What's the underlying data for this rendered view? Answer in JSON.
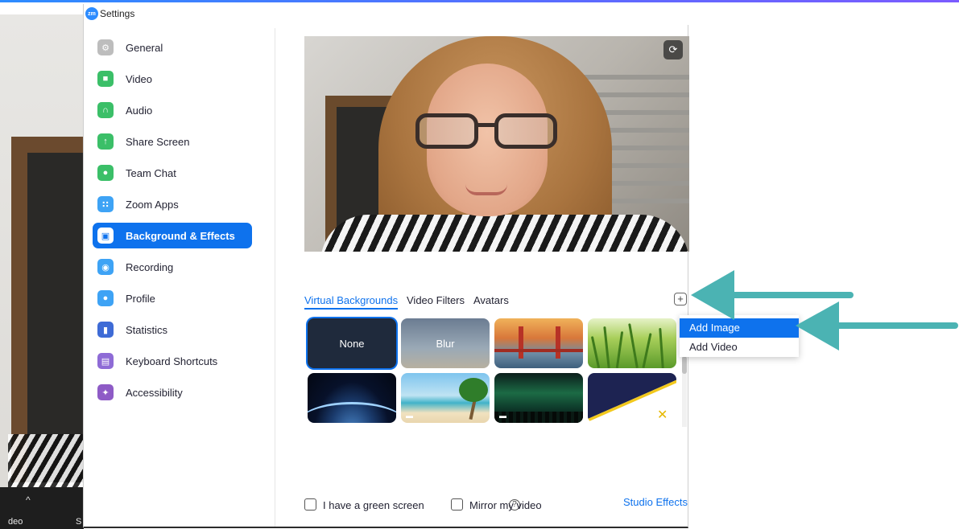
{
  "window": {
    "title": "Settings",
    "app_icon_text": "zm"
  },
  "sidebar": {
    "items": [
      {
        "label": "General",
        "icon": "gear-icon",
        "color": "#b6b6b6",
        "glyph": "⚙"
      },
      {
        "label": "Video",
        "icon": "video-camera-icon",
        "color": "#3bbf68",
        "glyph": "■"
      },
      {
        "label": "Audio",
        "icon": "headphones-icon",
        "color": "#3bbf68",
        "glyph": "∩"
      },
      {
        "label": "Share Screen",
        "icon": "share-screen-icon",
        "color": "#3bbf68",
        "glyph": "↑"
      },
      {
        "label": "Team Chat",
        "icon": "chat-bubble-icon",
        "color": "#3bbf68",
        "glyph": "●"
      },
      {
        "label": "Zoom Apps",
        "icon": "apps-icon",
        "color": "#3ea3f5",
        "glyph": "∷"
      },
      {
        "label": "Background & Effects",
        "icon": "background-person-icon",
        "color": "#ffffff",
        "glyph": "▣"
      },
      {
        "label": "Recording",
        "icon": "record-icon",
        "color": "#3ea3f5",
        "glyph": "◉"
      },
      {
        "label": "Profile",
        "icon": "profile-person-icon",
        "color": "#3ea3f5",
        "glyph": "●"
      },
      {
        "label": "Statistics",
        "icon": "bar-chart-icon",
        "color": "#3e6bd6",
        "glyph": "▮"
      },
      {
        "label": "Keyboard Shortcuts",
        "icon": "keyboard-icon",
        "color": "#8e6bd6",
        "glyph": "▤"
      },
      {
        "label": "Accessibility",
        "icon": "accessibility-icon",
        "color": "#8e5bc6",
        "glyph": "✦"
      }
    ],
    "active_index": 6
  },
  "preview": {
    "rotate_icon": "rotate-camera-icon",
    "rotate_glyph": "⟳"
  },
  "tabs": [
    {
      "label": "Virtual Backgrounds",
      "active": true
    },
    {
      "label": "Video Filters",
      "active": false
    },
    {
      "label": "Avatars",
      "active": false
    }
  ],
  "add_button": {
    "glyph": "+",
    "icon": "plus-icon"
  },
  "backgrounds": [
    {
      "label": "None",
      "kind": "none",
      "selected": true
    },
    {
      "label": "Blur",
      "kind": "blur",
      "selected": false
    },
    {
      "label": "",
      "kind": "golden-gate-bridge",
      "selected": false
    },
    {
      "label": "",
      "kind": "grass",
      "selected": false
    },
    {
      "label": "",
      "kind": "earth-from-space",
      "selected": false
    },
    {
      "label": "",
      "kind": "beach-palm",
      "selected": false
    },
    {
      "label": "",
      "kind": "northern-lights",
      "selected": false
    },
    {
      "label": "",
      "kind": "brand-graphic",
      "selected": false
    }
  ],
  "dropdown": {
    "items": [
      {
        "label": "Add Image",
        "highlighted": true
      },
      {
        "label": "Add Video",
        "highlighted": false
      }
    ]
  },
  "footer": {
    "green_screen_label": "I have a green screen",
    "mirror_label": "Mirror my video",
    "studio_effects_label": "Studio Effects",
    "help_glyph": "?"
  },
  "taskbar": {
    "text_left": "deo",
    "text_right": "S"
  },
  "colors": {
    "accent": "#0e72ed",
    "arrow": "#4bb3b3"
  }
}
